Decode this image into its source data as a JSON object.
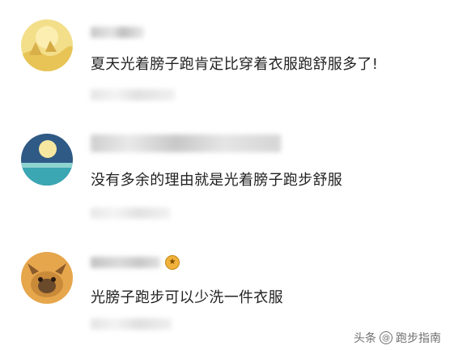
{
  "comments": [
    {
      "avatar": "desert-sun-avatar",
      "text": "夏天光着膀子跑肯定比穿着衣服跑舒服多了!"
    },
    {
      "avatar": "sea-moon-avatar",
      "text": "没有多余的理由就是光着膀子跑步舒服"
    },
    {
      "avatar": "dog-avatar",
      "text": "光膀子跑步可以少洗一件衣服",
      "badge_icon": "medal-icon"
    }
  ],
  "watermark": {
    "source": "头条",
    "at_symbol": "@",
    "account": "跑步指南"
  }
}
